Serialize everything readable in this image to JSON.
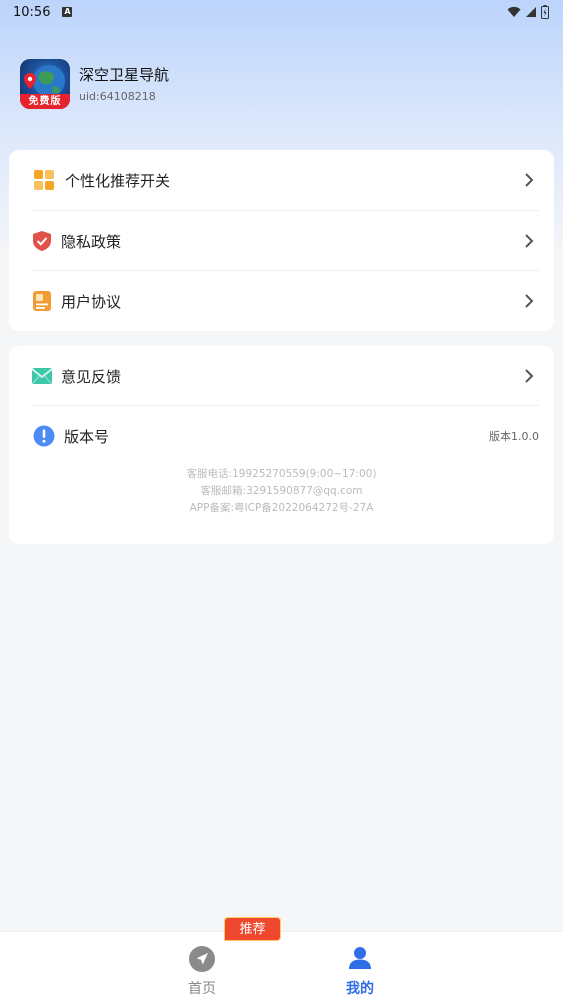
{
  "status_bar": {
    "time": "10:56",
    "notification_icon": "A"
  },
  "profile": {
    "app_name": "深空卫星导航",
    "uid": "uid:64108218",
    "logo_tag": "免费版"
  },
  "menu_group_1": [
    {
      "label": "个性化推荐开关",
      "icon": "grid-icon"
    },
    {
      "label": "隐私政策",
      "icon": "shield-icon"
    },
    {
      "label": "用户协议",
      "icon": "document-icon"
    }
  ],
  "menu_group_2": {
    "feedback_label": "意见反馈",
    "version_label": "版本号",
    "version_value": "版本1.0.0",
    "footer_lines": [
      "客服电话:19925270559(9:00~17:00)",
      "客服邮箱:3291590877@qq.com",
      "APP备案:粤ICP备2022064272号-27A"
    ]
  },
  "bottom_nav": {
    "badge": "推荐",
    "items": [
      {
        "label": "首页",
        "active": false
      },
      {
        "label": "我的",
        "active": true
      }
    ]
  },
  "colors": {
    "accent": "#2f6ee6",
    "badge": "#f0482e",
    "shield": "#e0524a",
    "grid": "#f5a623",
    "mail": "#3cc8a8",
    "info": "#4d8cf5"
  }
}
